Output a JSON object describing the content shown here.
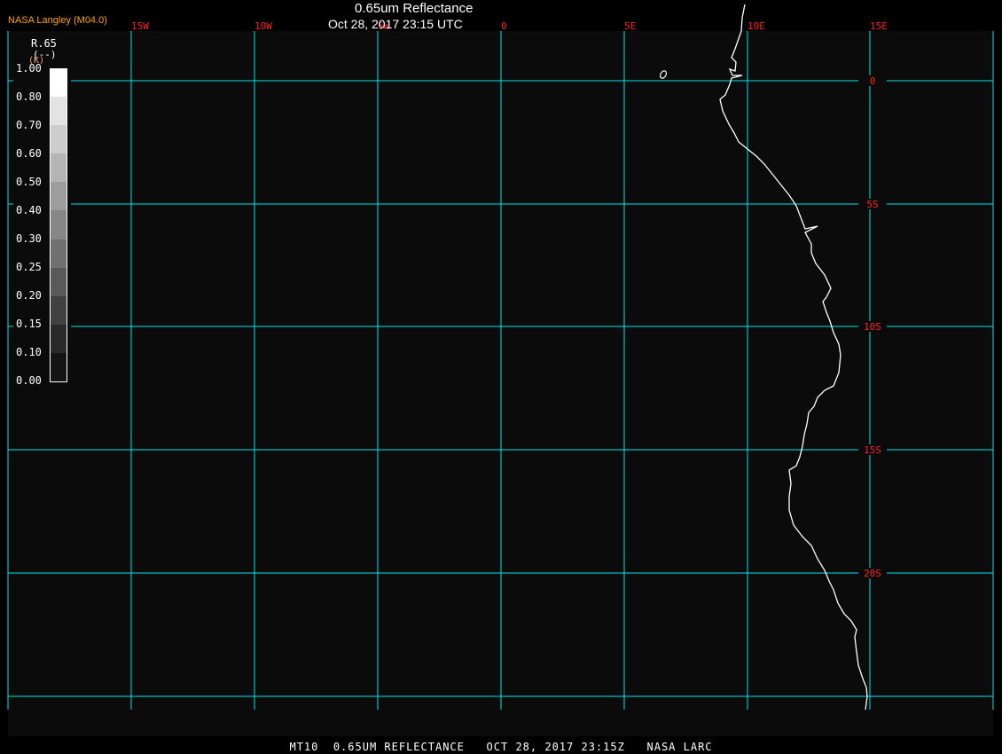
{
  "header": {
    "title": "0.65um Reflectance",
    "datetime": "Oct 28, 2017 23:15 UTC",
    "brand": "NASA Langley (M04.0)"
  },
  "footer": {
    "text": "MT10  0.65UM REFLECTANCE   OCT 28, 2017 23:15Z   NASA LARC"
  },
  "colorbar": {
    "variable": "R.65",
    "units": "(--)",
    "units_overlay": "(K)",
    "labels": [
      "1.00",
      "0.80",
      "0.70",
      "0.60",
      "0.50",
      "0.40",
      "0.30",
      "0.25",
      "0.20",
      "0.15",
      "0.10",
      "0.00"
    ],
    "colors": [
      "#ffffff",
      "#e3e3e3",
      "#cdcdcd",
      "#b5b5b5",
      "#9d9d9d",
      "#878787",
      "#707070",
      "#595959",
      "#414141",
      "#2a2a2a",
      "#141414"
    ]
  },
  "map": {
    "background": "#0b0b0b",
    "grid_color": "#00e5ee",
    "label_color": "#ff2020",
    "coast_color": "#ffffff",
    "lon_labels": [
      "15W",
      "10W",
      "5W",
      "0",
      "5E",
      "10E",
      "15E"
    ],
    "lat_labels": [
      "0",
      "5S",
      "10S",
      "15S",
      "20S"
    ]
  }
}
